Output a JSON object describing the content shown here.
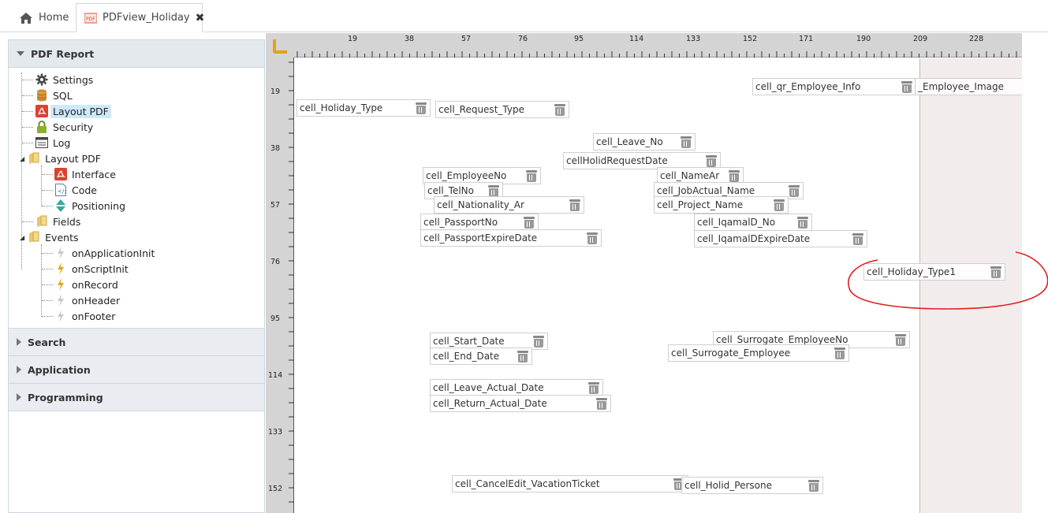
{
  "tabs": {
    "home_label": "Home",
    "active_label": "PDFview_Holiday"
  },
  "left_panel": {
    "pdf_report": {
      "title": "PDF Report",
      "items": [
        {
          "label": "Settings",
          "icon": "gear-icon"
        },
        {
          "label": "SQL",
          "icon": "database-icon"
        },
        {
          "label": "Layout PDF",
          "icon": "pdf-icon"
        },
        {
          "label": "Security",
          "icon": "lock-icon"
        },
        {
          "label": "Log",
          "icon": "log-icon"
        },
        {
          "label": "Layout PDF",
          "icon": "folder-icon"
        },
        {
          "label": "Interface",
          "icon": "pdf-icon"
        },
        {
          "label": "Code",
          "icon": "code-file-icon"
        },
        {
          "label": "Positioning",
          "icon": "positioning-icon"
        },
        {
          "label": "Fields",
          "icon": "folder-icon"
        },
        {
          "label": "Events",
          "icon": "folder-icon"
        },
        {
          "label": "onApplicationInit",
          "icon": "event-bolt-icon"
        },
        {
          "label": "onScriptInit",
          "icon": "event-bolt-icon"
        },
        {
          "label": "onRecord",
          "icon": "event-bolt-icon"
        },
        {
          "label": "onHeader",
          "icon": "event-bolt-icon"
        },
        {
          "label": "onFooter",
          "icon": "event-bolt-icon"
        }
      ]
    },
    "sections": [
      "Search",
      "Application",
      "Programming"
    ]
  },
  "ruler": {
    "top_ticks": [
      "19",
      "38",
      "57",
      "76",
      "95",
      "114",
      "133",
      "152",
      "171",
      "190",
      "209",
      "228"
    ],
    "left_ticks": [
      "19",
      "38",
      "57",
      "76",
      "95",
      "114",
      "133",
      "152"
    ]
  },
  "cells": [
    "cell_qr_Employee_Info",
    "_Employee_Image",
    "cell_Holiday_Type",
    "cell_Request_Type",
    "cell_Leave_No",
    "cellHolidRequestDate",
    "cell_EmployeeNo",
    "cell_NameAr",
    "cell_TelNo",
    "cell_JobActual_Name",
    "cell_Nationality_Ar",
    "cell_Project_Name",
    "cell_PassportNo",
    "cell_IqamalD_No",
    "cell_PassportExpireDate",
    "cell_IqamalDExpireDate",
    "cell_Holiday_Type1",
    "cell_Start_Date",
    "cell_Surrogate_EmployeeNo",
    "cell_End_Date",
    "cell_Surrogate_Employee",
    "cell_Leave_Actual_Date",
    "cell_Return_Actual_Date",
    "cell_CancelEdit_VacationTicket",
    "cell_Holid_Persone"
  ],
  "colors": {
    "annotation_circle": "#e02020",
    "margin_area": "#f3ecec",
    "ruler_bg": "#d4d4d4",
    "selected_bg": "#cfe8fb"
  }
}
